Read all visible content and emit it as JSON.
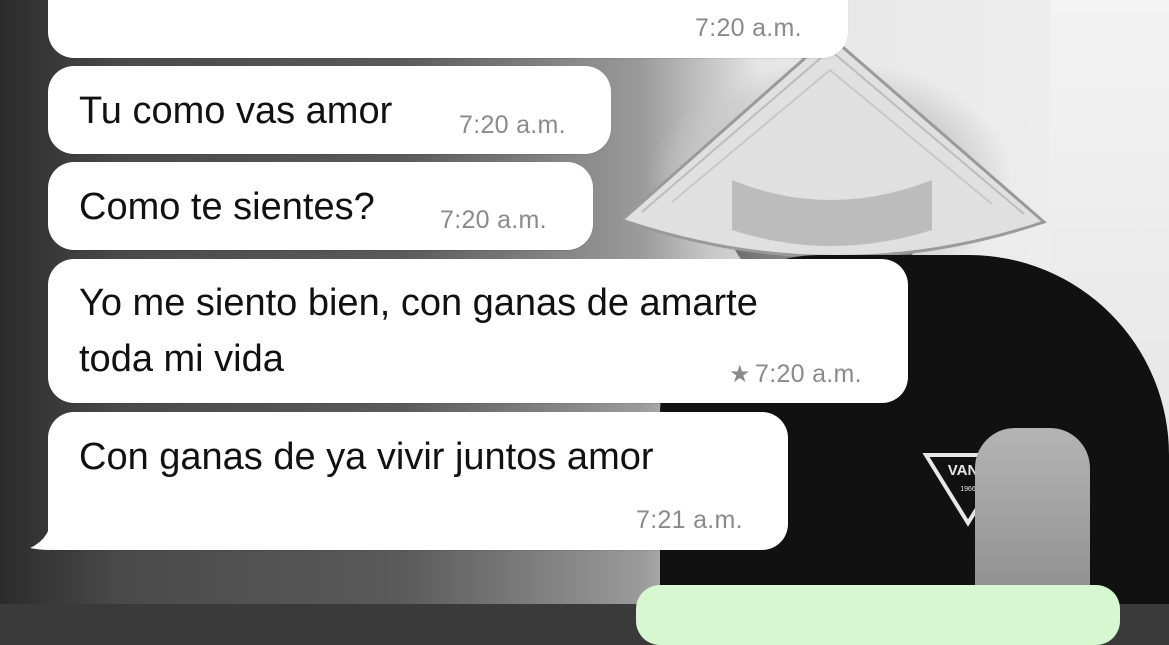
{
  "messages": [
    {
      "text": "",
      "time": "7:20 a.m."
    },
    {
      "text": "Tu como vas amor",
      "time": "7:20 a.m."
    },
    {
      "text": "Como te sientes?",
      "time": "7:20 a.m."
    },
    {
      "text_line1": "Yo me siento bien, con ganas de amarte",
      "text_line2": "toda mi vida",
      "time": "7:20 a.m.",
      "starred": true,
      "star_icon": "star-icon"
    },
    {
      "text": "Con ganas de ya vivir juntos amor",
      "time": "7:21 a.m."
    }
  ],
  "wallpaper": {
    "logo_text": "VANS",
    "logo_year": "1966"
  },
  "colors": {
    "incoming_bubble": "#ffffff",
    "outgoing_bubble": "#d7f7d0",
    "timestamp": "#8a8a8a",
    "text": "#111111"
  }
}
